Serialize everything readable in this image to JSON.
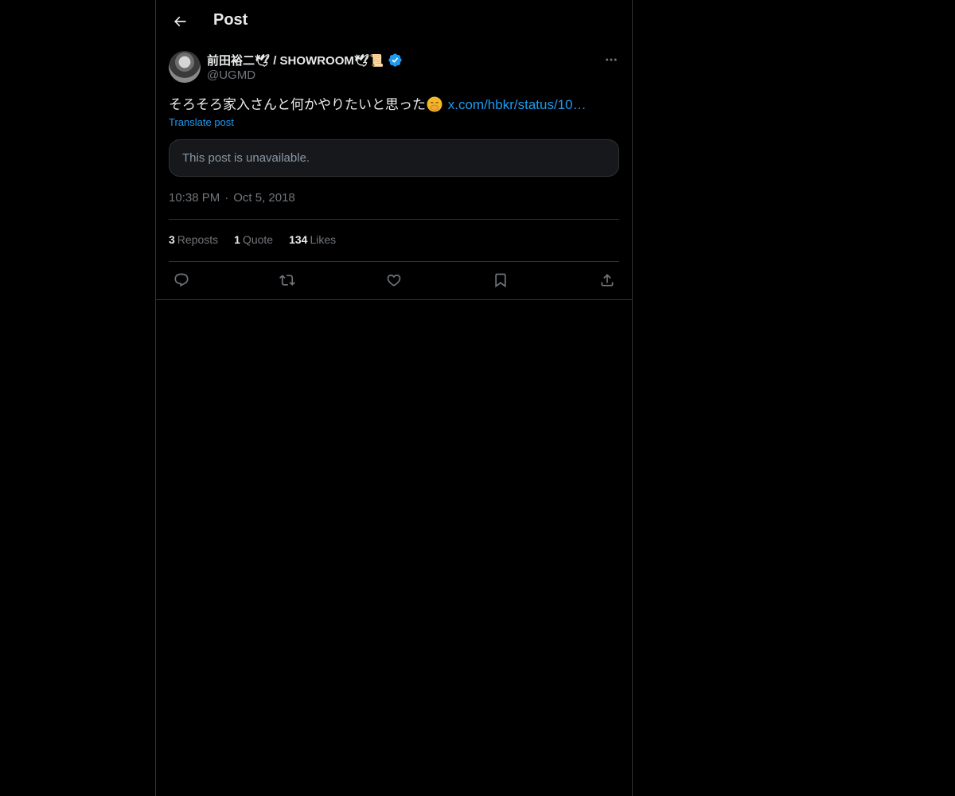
{
  "header": {
    "title": "Post"
  },
  "author": {
    "display_name": "前田裕二🕊 / SHOWROOM🕊📜",
    "handle": "@UGMD",
    "verified": true
  },
  "post": {
    "text": "そろそろ家入さんと何かやりたいと思った",
    "link": "x.com/hbkr/status/10…",
    "translate_label": "Translate post",
    "quoted_unavailable": "This post is unavailable.",
    "time": "10:38 PM",
    "date": "Oct 5, 2018"
  },
  "stats": {
    "reposts_count": "3",
    "reposts_label": "Reposts",
    "quotes_count": "1",
    "quotes_label": "Quote",
    "likes_count": "134",
    "likes_label": "Likes"
  },
  "icons": {
    "back": "back-arrow-icon",
    "verified": "verified-badge-icon",
    "more": "more-dots-icon",
    "reply": "reply-icon",
    "repost": "repost-icon",
    "like": "heart-icon",
    "bookmark": "bookmark-icon",
    "share": "share-icon"
  },
  "colors": {
    "background": "#000000",
    "text": "#e7e9ea",
    "secondary": "#71767b",
    "accent": "#1d9bf0",
    "border": "#2f3336"
  }
}
